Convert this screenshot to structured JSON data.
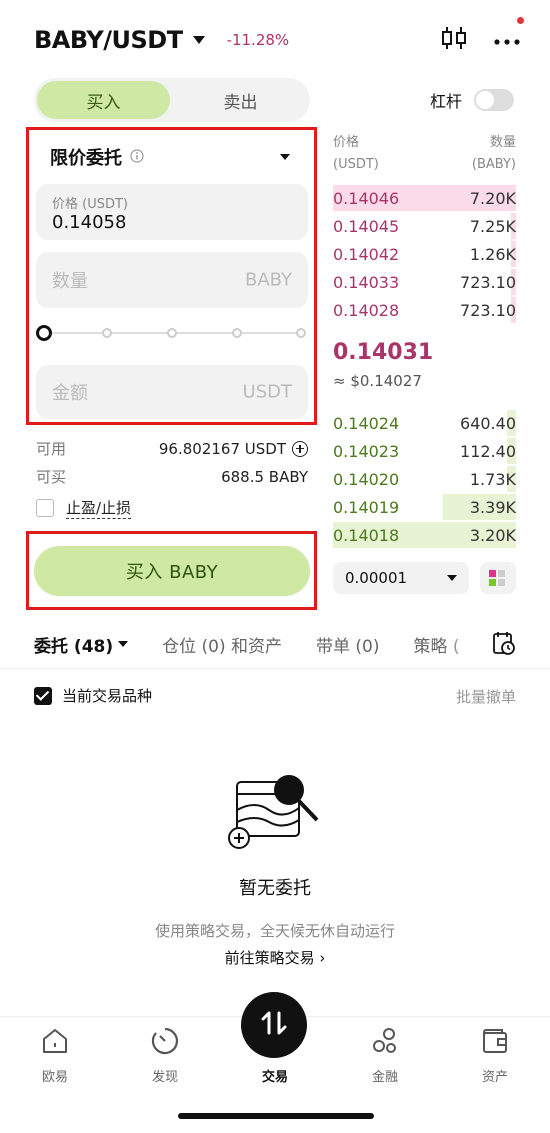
{
  "header": {
    "pair": "BABY/USDT",
    "change": "-11.28%"
  },
  "trade_tabs": {
    "buy": "买入",
    "sell": "卖出"
  },
  "leverage": {
    "label": "杠杆",
    "enabled": false
  },
  "order_form": {
    "order_type": "限价委托",
    "price_label": "价格 (USDT)",
    "price_value": "0.14058",
    "qty_placeholder": "数量",
    "qty_unit": "BABY",
    "amount_placeholder": "金额",
    "amount_unit": "USDT",
    "slider_percent": 0,
    "available_label": "可用",
    "available_value": "96.802167 USDT",
    "buyable_label": "可买",
    "buyable_value": "688.5 BABY",
    "tpsl_label": "止盈/止损",
    "submit_label": "买入 BABY"
  },
  "orderbook": {
    "price_header": "价格",
    "price_unit": "(USDT)",
    "qty_header": "数量",
    "qty_unit": "(BABY)",
    "asks": [
      {
        "price": "0.14046",
        "qty": "7.20K",
        "depth": 1.0
      },
      {
        "price": "0.14045",
        "qty": "7.25K",
        "depth": 0.03
      },
      {
        "price": "0.14042",
        "qty": "1.26K",
        "depth": 0.03
      },
      {
        "price": "0.14033",
        "qty": "723.10",
        "depth": 0.03
      },
      {
        "price": "0.14028",
        "qty": "723.10",
        "depth": 0.03
      }
    ],
    "mid_price": "0.14031",
    "mid_usd": "≈ $0.14027",
    "bids": [
      {
        "price": "0.14024",
        "qty": "640.40",
        "depth": 0.05
      },
      {
        "price": "0.14023",
        "qty": "112.40",
        "depth": 0.05
      },
      {
        "price": "0.14020",
        "qty": "1.73K",
        "depth": 0.05
      },
      {
        "price": "0.14019",
        "qty": "3.39K",
        "depth": 0.4
      },
      {
        "price": "0.14018",
        "qty": "3.20K",
        "depth": 1.0
      }
    ],
    "precision": "0.00001"
  },
  "order_tabs": [
    {
      "label": "委托 (48)"
    },
    {
      "label": "仓位 (0) 和资产"
    },
    {
      "label": "带单 (0)"
    },
    {
      "label": "策略 ("
    }
  ],
  "filter": {
    "current_pair_label": "当前交易品种",
    "current_pair_checked": true,
    "batch_cancel": "批量撤单"
  },
  "empty_state": {
    "title": "暂无委托",
    "desc": "使用策略交易，全天候无休自动运行",
    "link": "前往策略交易 ›"
  },
  "bottom_nav": [
    {
      "label": "欧易",
      "icon": "home-icon"
    },
    {
      "label": "发现",
      "icon": "discover-icon"
    },
    {
      "label": "交易",
      "icon": "trade-icon"
    },
    {
      "label": "金融",
      "icon": "finance-icon"
    },
    {
      "label": "资产",
      "icon": "wallet-icon"
    }
  ],
  "colors": {
    "buy_accent": "#cfe8a3",
    "ask": "#a9346a",
    "bid": "#4c7a1c",
    "highlight_frame": "#e01b1b"
  }
}
